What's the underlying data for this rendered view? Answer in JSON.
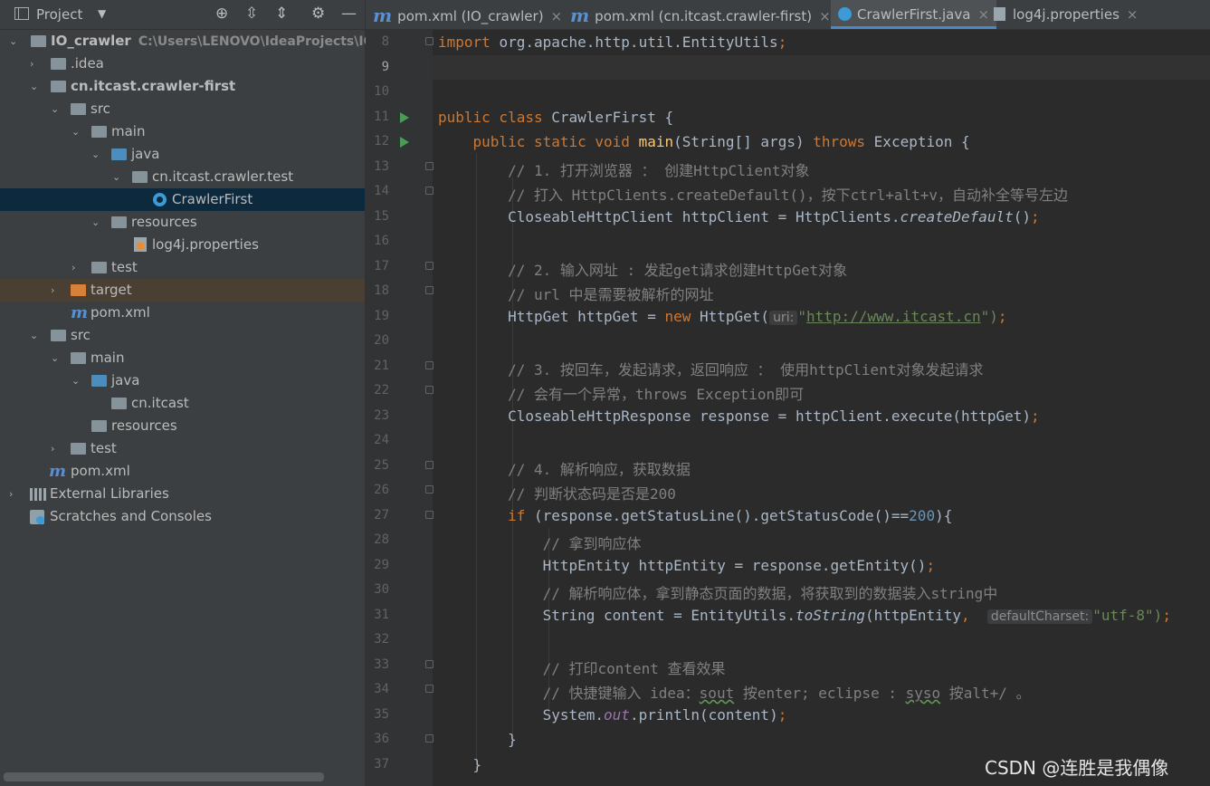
{
  "project_panel": {
    "title": "Project",
    "tree": [
      {
        "label": "IO_crawler",
        "hint": "C:\\Users\\LENOVO\\IdeaProjects\\IO_c"
      },
      {
        "label": ".idea"
      },
      {
        "label": "cn.itcast.crawler-first"
      },
      {
        "label": "src"
      },
      {
        "label": "main"
      },
      {
        "label": "java"
      },
      {
        "label": "cn.itcast.crawler.test"
      },
      {
        "label": "CrawlerFirst"
      },
      {
        "label": "resources"
      },
      {
        "label": "log4j.properties"
      },
      {
        "label": "test"
      },
      {
        "label": "target"
      },
      {
        "label": "pom.xml"
      },
      {
        "label": "src"
      },
      {
        "label": "main"
      },
      {
        "label": "java"
      },
      {
        "label": "cn.itcast"
      },
      {
        "label": "resources"
      },
      {
        "label": "test"
      },
      {
        "label": "pom.xml"
      },
      {
        "label": "External Libraries"
      },
      {
        "label": "Scratches and Consoles"
      }
    ]
  },
  "tabs": [
    {
      "label": "pom.xml (IO_crawler)",
      "icon": "maven-icon"
    },
    {
      "label": "pom.xml (cn.itcast.crawler-first)",
      "icon": "maven-icon"
    },
    {
      "label": "CrawlerFirst.java",
      "icon": "class-icon"
    },
    {
      "label": "log4j.properties",
      "icon": "properties-icon"
    }
  ],
  "close_glyph": "×",
  "line_numbers": [
    "8",
    "9",
    "10",
    "11",
    "12",
    "13",
    "14",
    "15",
    "16",
    "17",
    "18",
    "19",
    "20",
    "21",
    "22",
    "23",
    "24",
    "25",
    "26",
    "27",
    "28",
    "29",
    "30",
    "31",
    "32",
    "33",
    "34",
    "35",
    "36",
    "37"
  ],
  "code": {
    "l8": [
      "import",
      "org.apache.http.util.EntityUtils",
      ";"
    ],
    "l11": [
      "public class",
      "CrawlerFirst {"
    ],
    "l12": [
      "public static void",
      "main",
      "(String[] args)",
      "throws",
      "Exception {"
    ],
    "l13": "// 1. 打开浏览器 ： 创建HttpClient对象",
    "l14": "// 打入 HttpClients.createDefault()，按下ctrl+alt+v，自动补全等号左边",
    "l15": [
      "CloseableHttpClient httpClient = HttpClients.",
      "createDefault",
      "()",
      ";"
    ],
    "l17": "// 2. 输入网址 : 发起get请求创建HttpGet对象",
    "l18": "// url 中是需要被解析的网址",
    "l19": [
      "HttpGet httpGet = ",
      "new",
      " HttpGet(",
      "uri:",
      "\"",
      "http://www.itcast.cn",
      "\")",
      ";"
    ],
    "l21": "// 3. 按回车，发起请求，返回响应 ： 使用httpClient对象发起请求",
    "l22": "// 会有一个异常，throws Exception即可",
    "l23": [
      "CloseableHttpResponse response = httpClient.execute(httpGet)",
      ";"
    ],
    "l25": "// 4. 解析响应，获取数据",
    "l26": "// 判断状态码是否是200",
    "l27": [
      "if",
      " (response.getStatusLine().getStatusCode()==",
      "200",
      "){"
    ],
    "l28": "// 拿到响应体",
    "l29": [
      "HttpEntity httpEntity = response.getEntity()",
      ";"
    ],
    "l30": "// 解析响应体，拿到静态页面的数据，将获取到的数据装入string中",
    "l31": [
      "String content = EntityUtils.",
      "toString",
      "(httpEntity",
      ",",
      "defaultCharset:",
      "\"utf-8\")",
      ";"
    ],
    "l33": "// 打印content 查看效果",
    "l34": [
      "// 快捷键输入 idea：",
      "sout",
      " 按enter; eclipse : ",
      "syso",
      " 按alt+/ 。"
    ],
    "l35": [
      "System.",
      "out",
      ".println(content)",
      ";"
    ],
    "l36": "}",
    "l37": "}"
  },
  "watermark": "CSDN @连胜是我偶像"
}
